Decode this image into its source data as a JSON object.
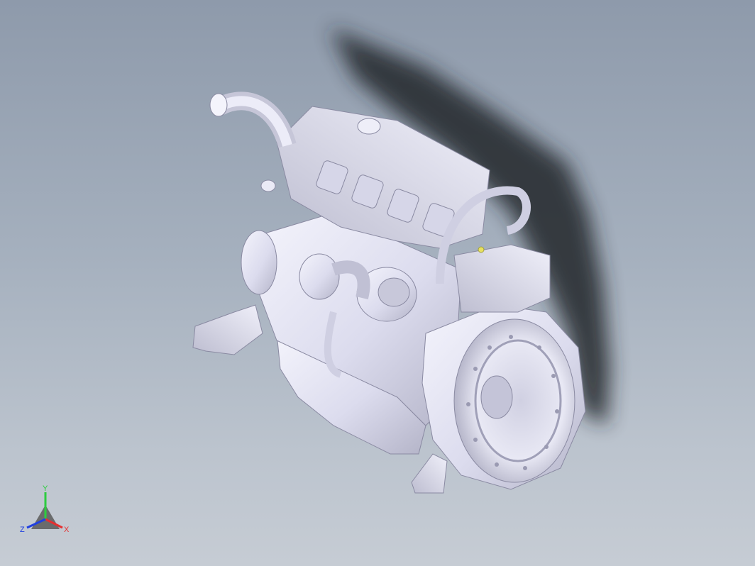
{
  "viewport": {
    "background_top": "#8e9aab",
    "background_bottom": "#c6ccd4",
    "model_color": "#e4e4f2",
    "model_shade": "#b8b8cc",
    "shadow_color": "#22262c"
  },
  "triad": {
    "x_label": "X",
    "y_label": "Y",
    "z_label": "Z",
    "x_color": "#e53030",
    "y_color": "#2ecc40",
    "z_color": "#2040e0"
  }
}
